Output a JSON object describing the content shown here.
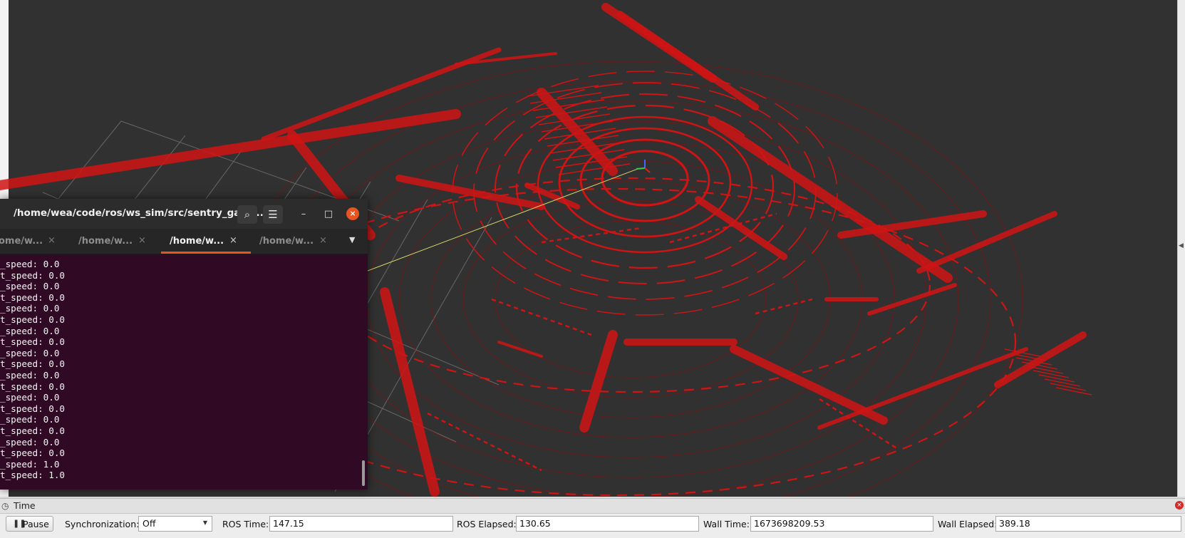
{
  "terminal": {
    "title": "/home/wea/code/ros/ws_sim/src/sentry_gaze...",
    "tabs": [
      {
        "label": "ome/w..."
      },
      {
        "label": "/home/w..."
      },
      {
        "label": "/home/w..."
      },
      {
        "label": "/home/w..."
      }
    ],
    "lines": [
      "_speed: 0.0",
      "t_speed: 0.0",
      "_speed: 0.0",
      "t_speed: 0.0",
      "_speed: 0.0",
      "t_speed: 0.0",
      "_speed: 0.0",
      "t_speed: 0.0",
      "_speed: 0.0",
      "t_speed: 0.0",
      "_speed: 0.0",
      "t_speed: 0.0",
      "_speed: 0.0",
      "t_speed: 0.0",
      "_speed: 0.0",
      "t_speed: 0.0",
      "_speed: 0.0",
      "t_speed: 0.0",
      "_speed: 1.0",
      "t_speed: 1.0"
    ],
    "background": "#300a24",
    "accent": "#e95420"
  },
  "viewport": {
    "background": "#313131",
    "point_color": "#d01414",
    "grid_color": "#7a7a7a",
    "axis_line_color": "#d8d66a"
  },
  "time_panel": {
    "title": "Time",
    "pause_label": "Pause",
    "sync_label": "Synchronization:",
    "sync_value": "Off",
    "ros_time_label": "ROS Time:",
    "ros_time_value": "147.15",
    "ros_elapsed_label": "ROS Elapsed:",
    "ros_elapsed_value": "130.65",
    "wall_time_label": "Wall Time:",
    "wall_time_value": "1673698209.53",
    "wall_elapsed_label": "Wall Elapsed:",
    "wall_elapsed_value": "389.18"
  }
}
